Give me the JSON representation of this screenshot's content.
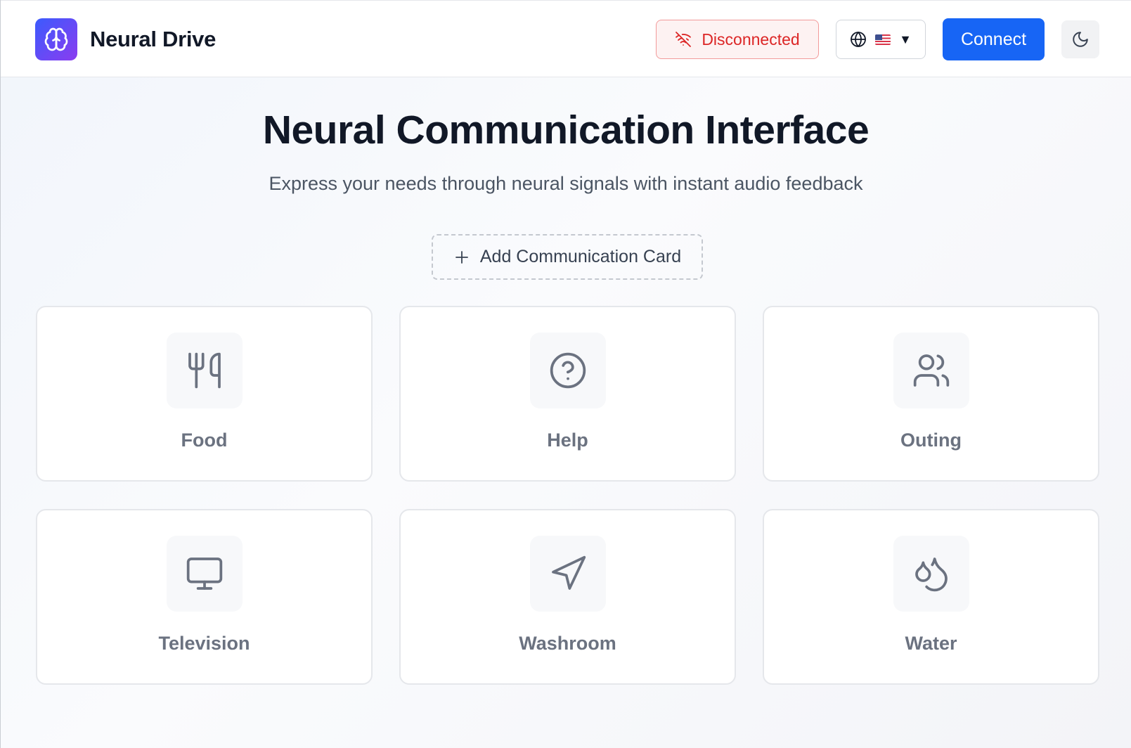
{
  "header": {
    "brand": "Neural Drive",
    "logo_icon": "brain-icon",
    "status": {
      "label": "Disconnected",
      "icon": "wifi-off-icon",
      "color": "#dc2626"
    },
    "language": {
      "icon": "globe-icon",
      "flag": "us-flag",
      "caret": "▼"
    },
    "connect_label": "Connect",
    "theme_icon": "moon-icon"
  },
  "main": {
    "title": "Neural Communication Interface",
    "subtitle": "Express your needs through neural signals with instant audio feedback",
    "add_card_label": "Add Communication Card",
    "cards": [
      {
        "label": "Food",
        "icon": "utensils-icon"
      },
      {
        "label": "Help",
        "icon": "help-circle-icon"
      },
      {
        "label": "Outing",
        "icon": "users-icon"
      },
      {
        "label": "Television",
        "icon": "monitor-icon"
      },
      {
        "label": "Washroom",
        "icon": "navigation-icon"
      },
      {
        "label": "Water",
        "icon": "droplets-icon"
      }
    ]
  },
  "colors": {
    "accent": "#1765f5",
    "logo_gradient_start": "#3b5bfd",
    "logo_gradient_end": "#8b3cf0",
    "status_error": "#dc2626"
  }
}
